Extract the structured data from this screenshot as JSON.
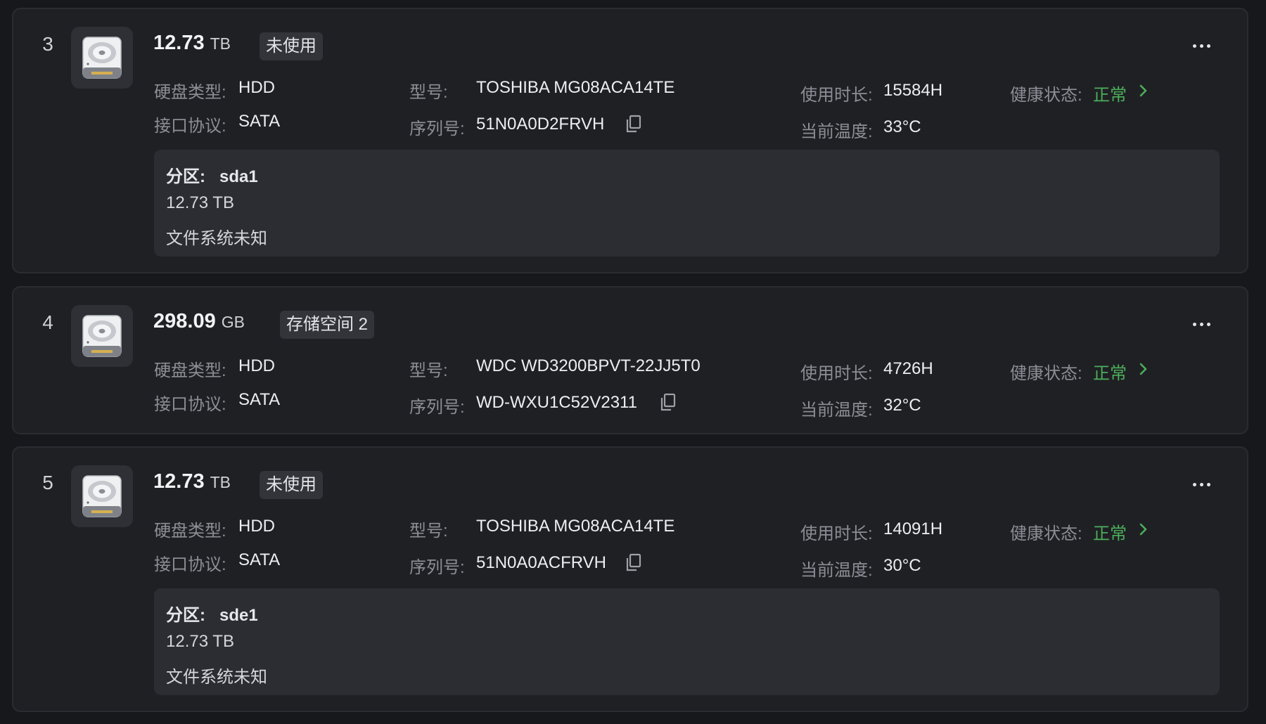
{
  "labels": {
    "disk_type": "硬盘类型:",
    "model": "型号:",
    "runtime": "使用时长:",
    "health": "健康状态:",
    "protocol": "接口协议:",
    "serial": "序列号:",
    "temperature": "当前温度:",
    "partition": "分区:"
  },
  "colors": {
    "ok": "#4cae5a",
    "card": "#1f2024",
    "bg": "#17181b"
  },
  "disks": [
    {
      "index": "3",
      "capacity": "12.73",
      "unit": "TB",
      "tag": "未使用",
      "type": "HDD",
      "protocol": "SATA",
      "model": "TOSHIBA MG08ACA14TE",
      "serial": "51N0A0D2FRVH",
      "runtime": "15584H",
      "temperature": "33°C",
      "health": "正常",
      "partition": {
        "name": "sda1",
        "size": "12.73 TB",
        "fs": "文件系统未知"
      }
    },
    {
      "index": "4",
      "capacity": "298.09",
      "unit": "GB",
      "tag": "存储空间 2",
      "type": "HDD",
      "protocol": "SATA",
      "model": "WDC WD3200BPVT-22JJ5T0",
      "serial": "WD-WXU1C52V2311",
      "runtime": "4726H",
      "temperature": "32°C",
      "health": "正常"
    },
    {
      "index": "5",
      "capacity": "12.73",
      "unit": "TB",
      "tag": "未使用",
      "type": "HDD",
      "protocol": "SATA",
      "model": "TOSHIBA MG08ACA14TE",
      "serial": "51N0A0ACFRVH",
      "runtime": "14091H",
      "temperature": "30°C",
      "health": "正常",
      "partition": {
        "name": "sde1",
        "size": "12.73 TB",
        "fs": "文件系统未知"
      }
    }
  ]
}
